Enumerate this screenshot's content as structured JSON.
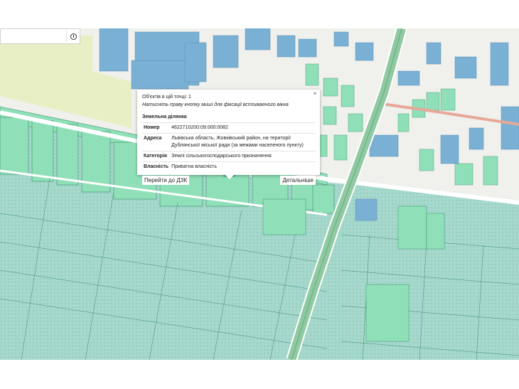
{
  "search": {
    "value": "",
    "info_icon": "info-icon"
  },
  "map": {
    "colors": {
      "agri": "#a6d8cc",
      "agri_dot": "#6fb6a8",
      "parcel": "#8fe0b8",
      "building": "#79b0d4",
      "road": "#ffffff",
      "main_road": "#8fc9a1",
      "railway": "#e8a898"
    },
    "labels": []
  },
  "popup": {
    "count_text": "Об'єктів в цій точці: 1",
    "hint_text": "Натисніть праву кнопку миші для фіксації вспливаючого вікна",
    "section_title": "Земельна ділянка",
    "rows": [
      {
        "key": "Номер",
        "value": "4622710200:09:000:0082"
      },
      {
        "key": "Адреса",
        "value": "Львівська область, Жовківський район, на території Дублянської міської ради (за межами населеного пункту)"
      },
      {
        "key": "Категорія",
        "value": "Землі сільськогосподарського призначення"
      },
      {
        "key": "Власність",
        "value": "Приватна власність"
      }
    ],
    "btn_dzk": "Перейти до ДЗК",
    "btn_details": "Детальніше",
    "close_glyph": "×"
  }
}
